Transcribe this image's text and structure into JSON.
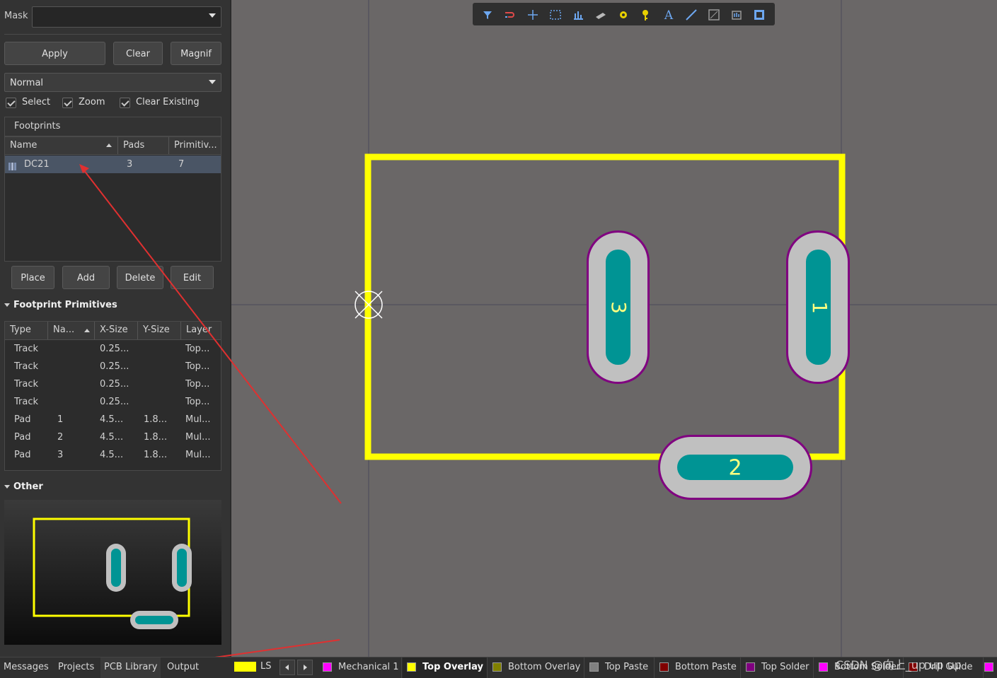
{
  "mask": {
    "label": "Mask",
    "value": ""
  },
  "buttons": {
    "apply": "Apply",
    "clear": "Clear",
    "magnify": "Magnif"
  },
  "mode": {
    "value": "Normal"
  },
  "checks": {
    "select": "Select",
    "zoom": "Zoom",
    "clear_existing": "Clear Existing"
  },
  "footprints": {
    "title": "Footprints",
    "columns": [
      "Name",
      "Pads",
      "Primitiv..."
    ],
    "rows": [
      {
        "name": "DC21",
        "pads": "3",
        "primitives": "7"
      }
    ]
  },
  "fp_buttons": {
    "place": "Place",
    "add": "Add",
    "delete": "Delete",
    "edit": "Edit"
  },
  "primitives": {
    "title": "Footprint Primitives",
    "columns": [
      "Type",
      "Na...",
      "X-Size",
      "Y-Size",
      "Layer"
    ],
    "rows": [
      {
        "type": "Track",
        "name": "",
        "x": "0.25...",
        "y": "",
        "layer": "Top..."
      },
      {
        "type": "Track",
        "name": "",
        "x": "0.25...",
        "y": "",
        "layer": "Top..."
      },
      {
        "type": "Track",
        "name": "",
        "x": "0.25...",
        "y": "",
        "layer": "Top..."
      },
      {
        "type": "Track",
        "name": "",
        "x": "0.25...",
        "y": "",
        "layer": "Top..."
      },
      {
        "type": "Pad",
        "name": "1",
        "x": "4.5...",
        "y": "1.8...",
        "layer": "Mul..."
      },
      {
        "type": "Pad",
        "name": "2",
        "x": "4.5...",
        "y": "1.8...",
        "layer": "Mul..."
      },
      {
        "type": "Pad",
        "name": "3",
        "x": "4.5...",
        "y": "1.8...",
        "layer": "Mul..."
      }
    ]
  },
  "other": {
    "title": "Other"
  },
  "pcb": {
    "pad1": "1",
    "pad2": "2",
    "pad3": "3"
  },
  "toolbar_icons": [
    "filter-icon",
    "route-icon",
    "place-icon",
    "select-rect-icon",
    "chart-icon",
    "component-icon",
    "via-icon",
    "pad-icon",
    "text-icon",
    "line-icon",
    "measure-icon",
    "region-icon",
    "board-icon"
  ],
  "bottom_tabs": [
    "Messages",
    "Projects",
    "PCB Library",
    "Output"
  ],
  "ls": "LS",
  "layers": [
    {
      "name": "Mechanical 1",
      "color": "#ff00ff",
      "active": false
    },
    {
      "name": "Top Overlay",
      "color": "#ffff00",
      "active": true
    },
    {
      "name": "Bottom Overlay",
      "color": "#808000",
      "active": false
    },
    {
      "name": "Top Paste",
      "color": "#808080",
      "active": false
    },
    {
      "name": "Bottom Paste",
      "color": "#800000",
      "active": false
    },
    {
      "name": "Top Solder",
      "color": "#800080",
      "active": false
    },
    {
      "name": "Bottom Solder",
      "color": "#ff00ff",
      "active": false
    },
    {
      "name": "Drill Guide",
      "color": "#800000",
      "active": false
    }
  ],
  "watermark": "CSDN @向上_up up up",
  "colors": {
    "overlay": "#ffff00",
    "pad_copper": "#009494",
    "pad_ring": "#c0c0c0",
    "pad_mask": "#800080",
    "canvas": "#6a6767",
    "arrow": "#e03030"
  }
}
